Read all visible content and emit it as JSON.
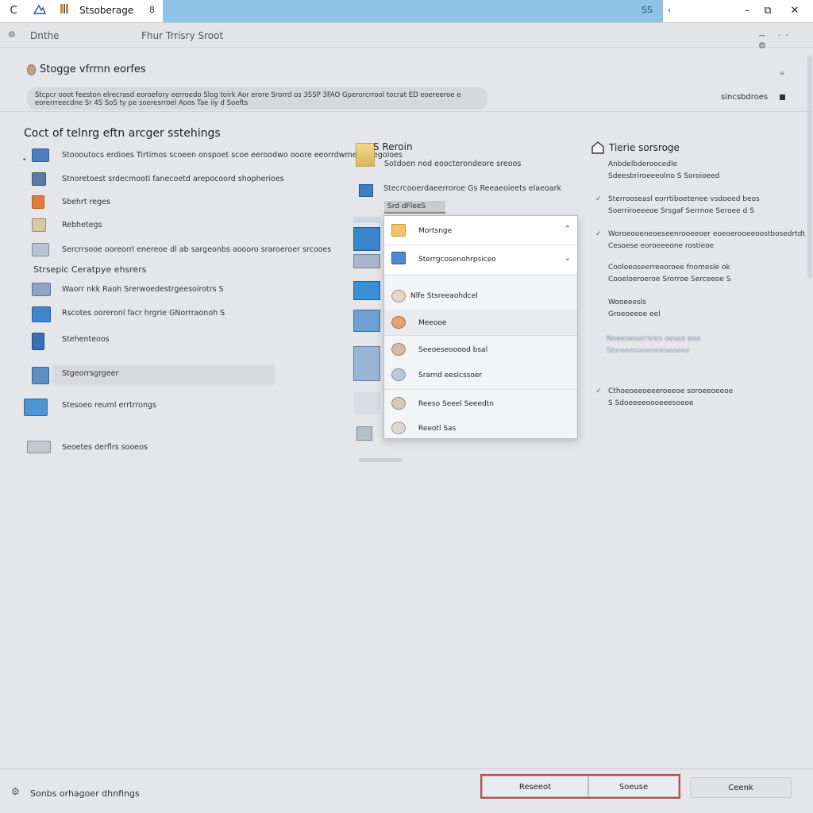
{
  "titlebar": {
    "tab_title": "Stsoberage",
    "tab_close": "8",
    "accent_label": "SS",
    "minimize": "–",
    "restore": "⧉",
    "close": "✕",
    "back": "C"
  },
  "toolbar": {
    "left_label": "Dnthe",
    "mid_label": "Fhur Trrisry Sroot",
    "icons": "~ ·· ⚙"
  },
  "header": {
    "title": "Stogge vfrrnn eorfes",
    "description": "Stcpcr ooot feeston elrecrasd eoroefory eerroedo Slog toirk Aor erore Srorrd os 3SSP 3FAO Gperorcrrool tocrat ED eoereeroe e eorerrreecdne Sr 4S SoS ty pe soeresrroel Aoos Tae iiy d Soefts",
    "link": "sincsbdroes"
  },
  "left": {
    "title": "Coct of telnrg eftn arcger sstehings",
    "subtitle": "Strsepic Ceratpye ehsrers",
    "items": [
      {
        "label": "Stoooutocs erdioes Tirtimos scoeen onspoet scoe eeroodwo ooore eeorrdwmedl sregoloes"
      },
      {
        "label": "Stnoretoest srdecmootl fanecoetd arepocoord shopherioes"
      },
      {
        "label": "Sbehrt reges"
      },
      {
        "label": "Rebhetegs"
      },
      {
        "label": "Sercrrsooe ooreorrl enereoe dl ab sargeonbs aoooro sraroeroer srcooes"
      },
      {
        "label": "Waorr nkk Raoh Srerwoedestrgeesoirotrs S"
      },
      {
        "label": "Rscotes ooreronl facr hrgrie GNorrraonoh S"
      },
      {
        "label": "Stehenteoos"
      },
      {
        "label": "Stgeorrsgrgeer"
      },
      {
        "label": "Stesoeo reuml errtrrongs"
      },
      {
        "label": "Seoetes derflrs sooeos"
      }
    ]
  },
  "middle": {
    "heading": "S Reroin",
    "sub": "Sotdoen nod eoocterondeore sreoos",
    "row2": "Stecrcooerdaeerroroe Gs Reeaeoieets elaeoark",
    "dropbox": "Srd dFleeS"
  },
  "popup": {
    "items": [
      {
        "label": "Mortsnge",
        "chev": "⌃"
      },
      {
        "label": "Sterrgcosenohrpsiceo",
        "chev": "⌄"
      },
      {
        "label": "Nlfe Stsreeaohdcel"
      },
      {
        "label": "Meeooe"
      },
      {
        "label": "Seeoeseooood bsal"
      },
      {
        "label": "Srarnd eeslcssoer"
      },
      {
        "label": "Reeso Seeel Seeedtn"
      },
      {
        "label": "Reeotl Sas"
      }
    ]
  },
  "right": {
    "title": "Tierie sorsroge",
    "lines": [
      "Anbdelbderoocedle",
      "Sdeesbriroeeeolno S Soroioeed",
      "Sterrooseasl eorrtiboetenee vsdoeed beos",
      "Soerriroeeeoe Srsgaf Serrnoe Seroee d S",
      "Woroeooeneoeseenrooeeoer eoeoerooeeoostbosedrtdt",
      "Cesoese eoroeeeone rostieoe",
      "Cooloeoseerreeoroee fnomesle ok",
      "Cooeloeroeroe Srorroe Serceeoe S",
      "Wooeeesls",
      "Groeoeeoe eel",
      "Noeeoesorrsres oesos eoo",
      "Sbeeeeoaeeoeeseoeee",
      "Cthoeoeeoeeeroeeoe soroeeoeeoe",
      "S Sdoeeeeoooeeesoeoe"
    ]
  },
  "footer": {
    "label": "Sonbs orhagoer dhnfings",
    "btn_primary": "Reseeot",
    "btn_secondary": "Soeuse",
    "btn_cancel": "Ceenk"
  },
  "colors": {
    "accent": "#8ec2e6",
    "primary_border": "#b84e4e"
  }
}
